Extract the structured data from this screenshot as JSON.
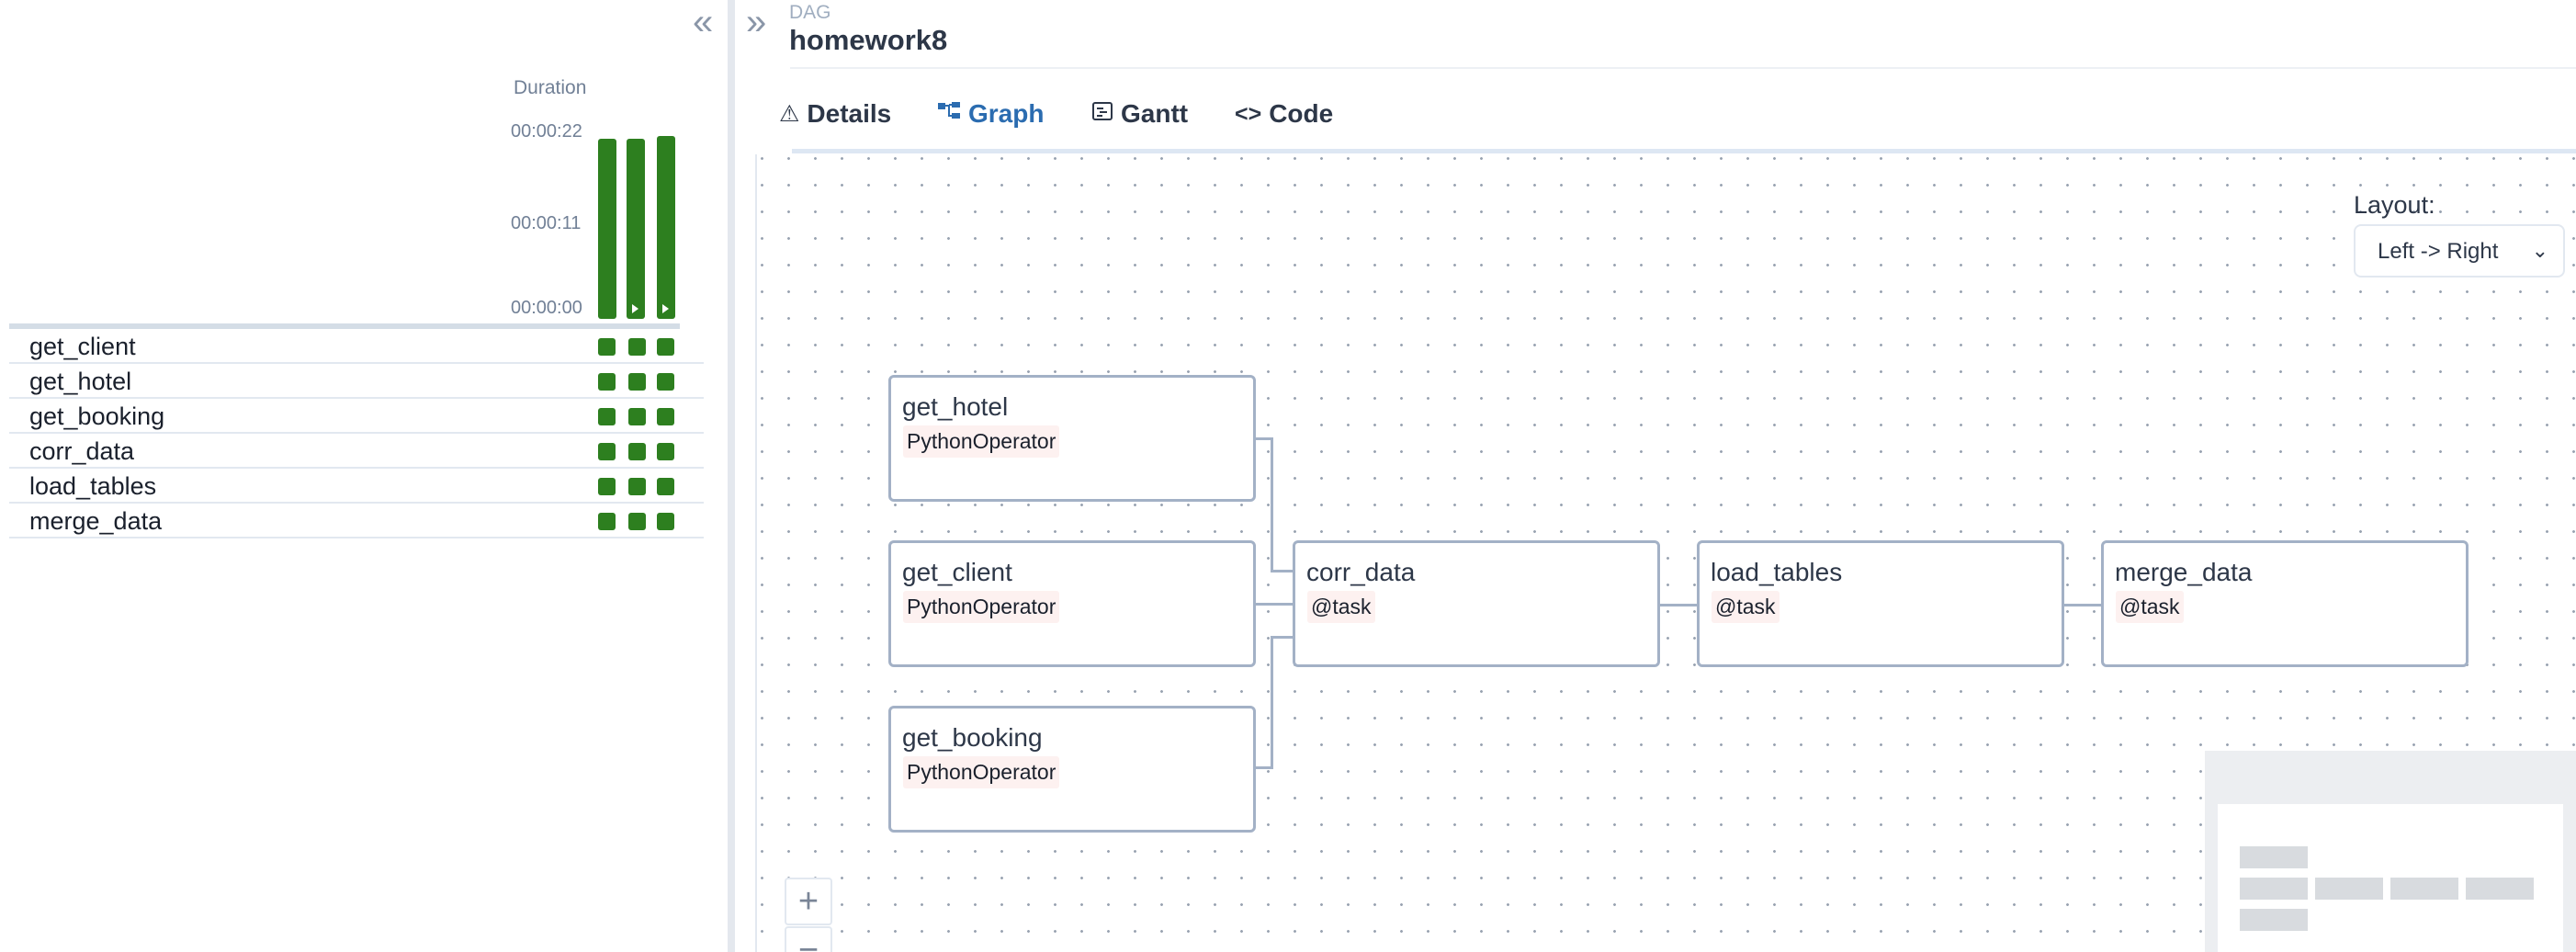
{
  "grid": {
    "duration_label": "Duration",
    "ticks": [
      "00:00:22",
      "00:00:11",
      "00:00:00"
    ],
    "tasks": [
      "get_client",
      "get_hotel",
      "get_booking",
      "corr_data",
      "load_tables",
      "merge_data"
    ],
    "status_color": "#2d7f1f"
  },
  "dag": {
    "label": "DAG",
    "title": "homework8"
  },
  "tabs": {
    "details": "Details",
    "graph": "Graph",
    "gantt": "Gantt",
    "code": "Code",
    "active": "Graph"
  },
  "graph": {
    "layout_label": "Layout:",
    "layout_value": "Left -> Right",
    "nodes": {
      "get_hotel": {
        "name": "get_hotel",
        "operator": "PythonOperator"
      },
      "get_client": {
        "name": "get_client",
        "operator": "PythonOperator"
      },
      "get_booking": {
        "name": "get_booking",
        "operator": "PythonOperator"
      },
      "corr_data": {
        "name": "corr_data",
        "operator": "@task"
      },
      "load_tables": {
        "name": "load_tables",
        "operator": "@task"
      },
      "merge_data": {
        "name": "merge_data",
        "operator": "@task"
      }
    },
    "zoom_in": "+",
    "zoom_out": "−"
  },
  "icons": {
    "collapse": "chevrons-left-icon",
    "expand": "chevrons-right-icon",
    "details": "warning-triangle-icon",
    "graph": "graph-tree-icon",
    "gantt": "gantt-chart-icon",
    "code": "code-brackets-icon",
    "select": "chevron-down-icon"
  }
}
